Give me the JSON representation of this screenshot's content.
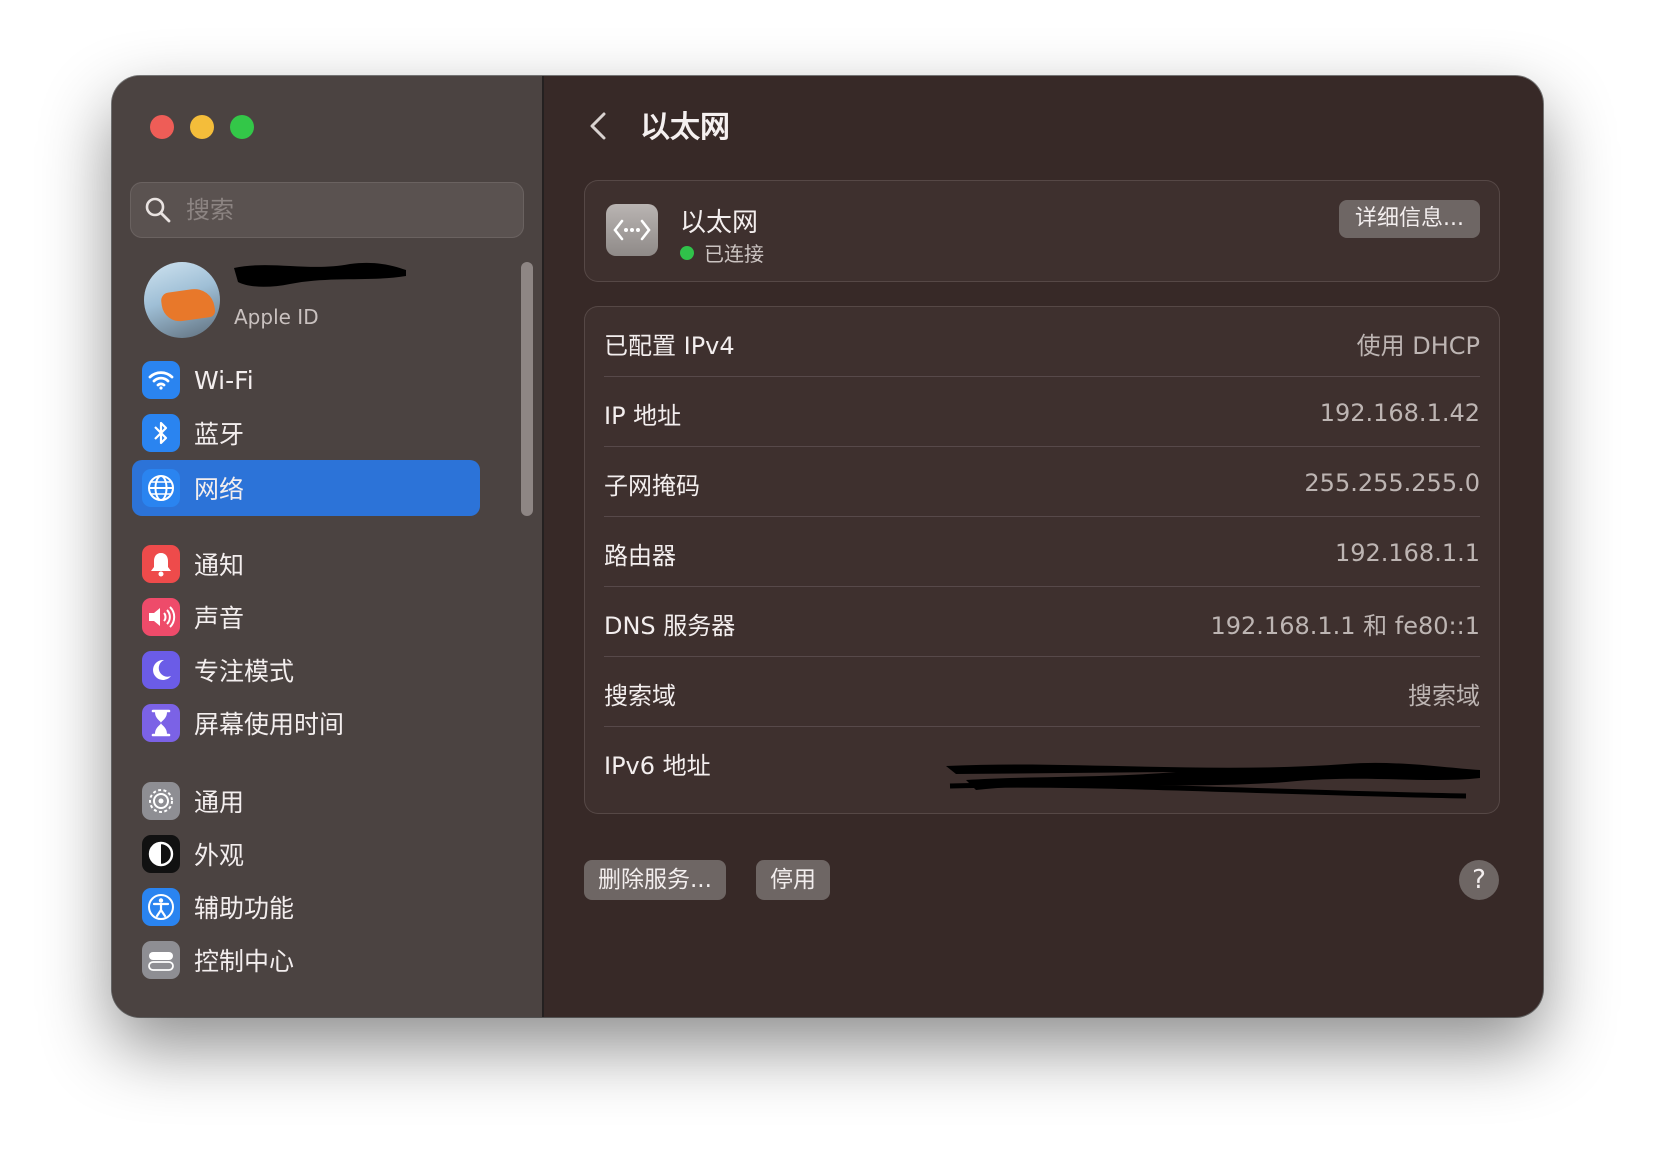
{
  "window": {
    "colors": {
      "close": "#ee5d57",
      "minimize": "#f4bd3a",
      "zoom": "#33c748",
      "accent": "#2c73d8"
    }
  },
  "sidebar": {
    "search_placeholder": "搜索",
    "account": {
      "name": "",
      "subtitle": "Apple ID"
    },
    "items": [
      {
        "label": "Wi-Fi",
        "icon": "wifi-icon",
        "color": "#2a84f0"
      },
      {
        "label": "蓝牙",
        "icon": "bluetooth-icon",
        "color": "#2a84f0"
      },
      {
        "label": "网络",
        "icon": "globe-icon",
        "color": "#2a84f0",
        "selected": true
      },
      {
        "label": "通知",
        "icon": "bell-icon",
        "color": "#ee4b4b"
      },
      {
        "label": "声音",
        "icon": "speaker-icon",
        "color": "#ee4b6a"
      },
      {
        "label": "专注模式",
        "icon": "moon-icon",
        "color": "#6b5ce7"
      },
      {
        "label": "屏幕使用时间",
        "icon": "hourglass-icon",
        "color": "#7b62e6"
      },
      {
        "label": "通用",
        "icon": "gear-icon",
        "color": "#8e8e93"
      },
      {
        "label": "外观",
        "icon": "appearance-icon",
        "color": "#111111"
      },
      {
        "label": "辅助功能",
        "icon": "accessibility-icon",
        "color": "#2a84f0"
      },
      {
        "label": "控制中心",
        "icon": "control-center-icon",
        "color": "#8e8e93"
      }
    ]
  },
  "main": {
    "title": "以太网",
    "service": {
      "name": "以太网",
      "status": "已连接",
      "status_color": "#30c24a",
      "details_button": "详细信息..."
    },
    "info_rows": [
      {
        "label": "已配置 IPv4",
        "value": "使用 DHCP"
      },
      {
        "label": "IP 地址",
        "value": "192.168.1.42"
      },
      {
        "label": "子网掩码",
        "value": "255.255.255.0"
      },
      {
        "label": "路由器",
        "value": "192.168.1.1"
      },
      {
        "label": "DNS 服务器",
        "value": "192.168.1.1 和 fe80::1"
      },
      {
        "label": "搜索域",
        "value": "搜索域"
      },
      {
        "label": "IPv6 地址",
        "value": ""
      }
    ],
    "remove_button": "删除服务...",
    "disable_button": "停用",
    "help_label": "?"
  }
}
